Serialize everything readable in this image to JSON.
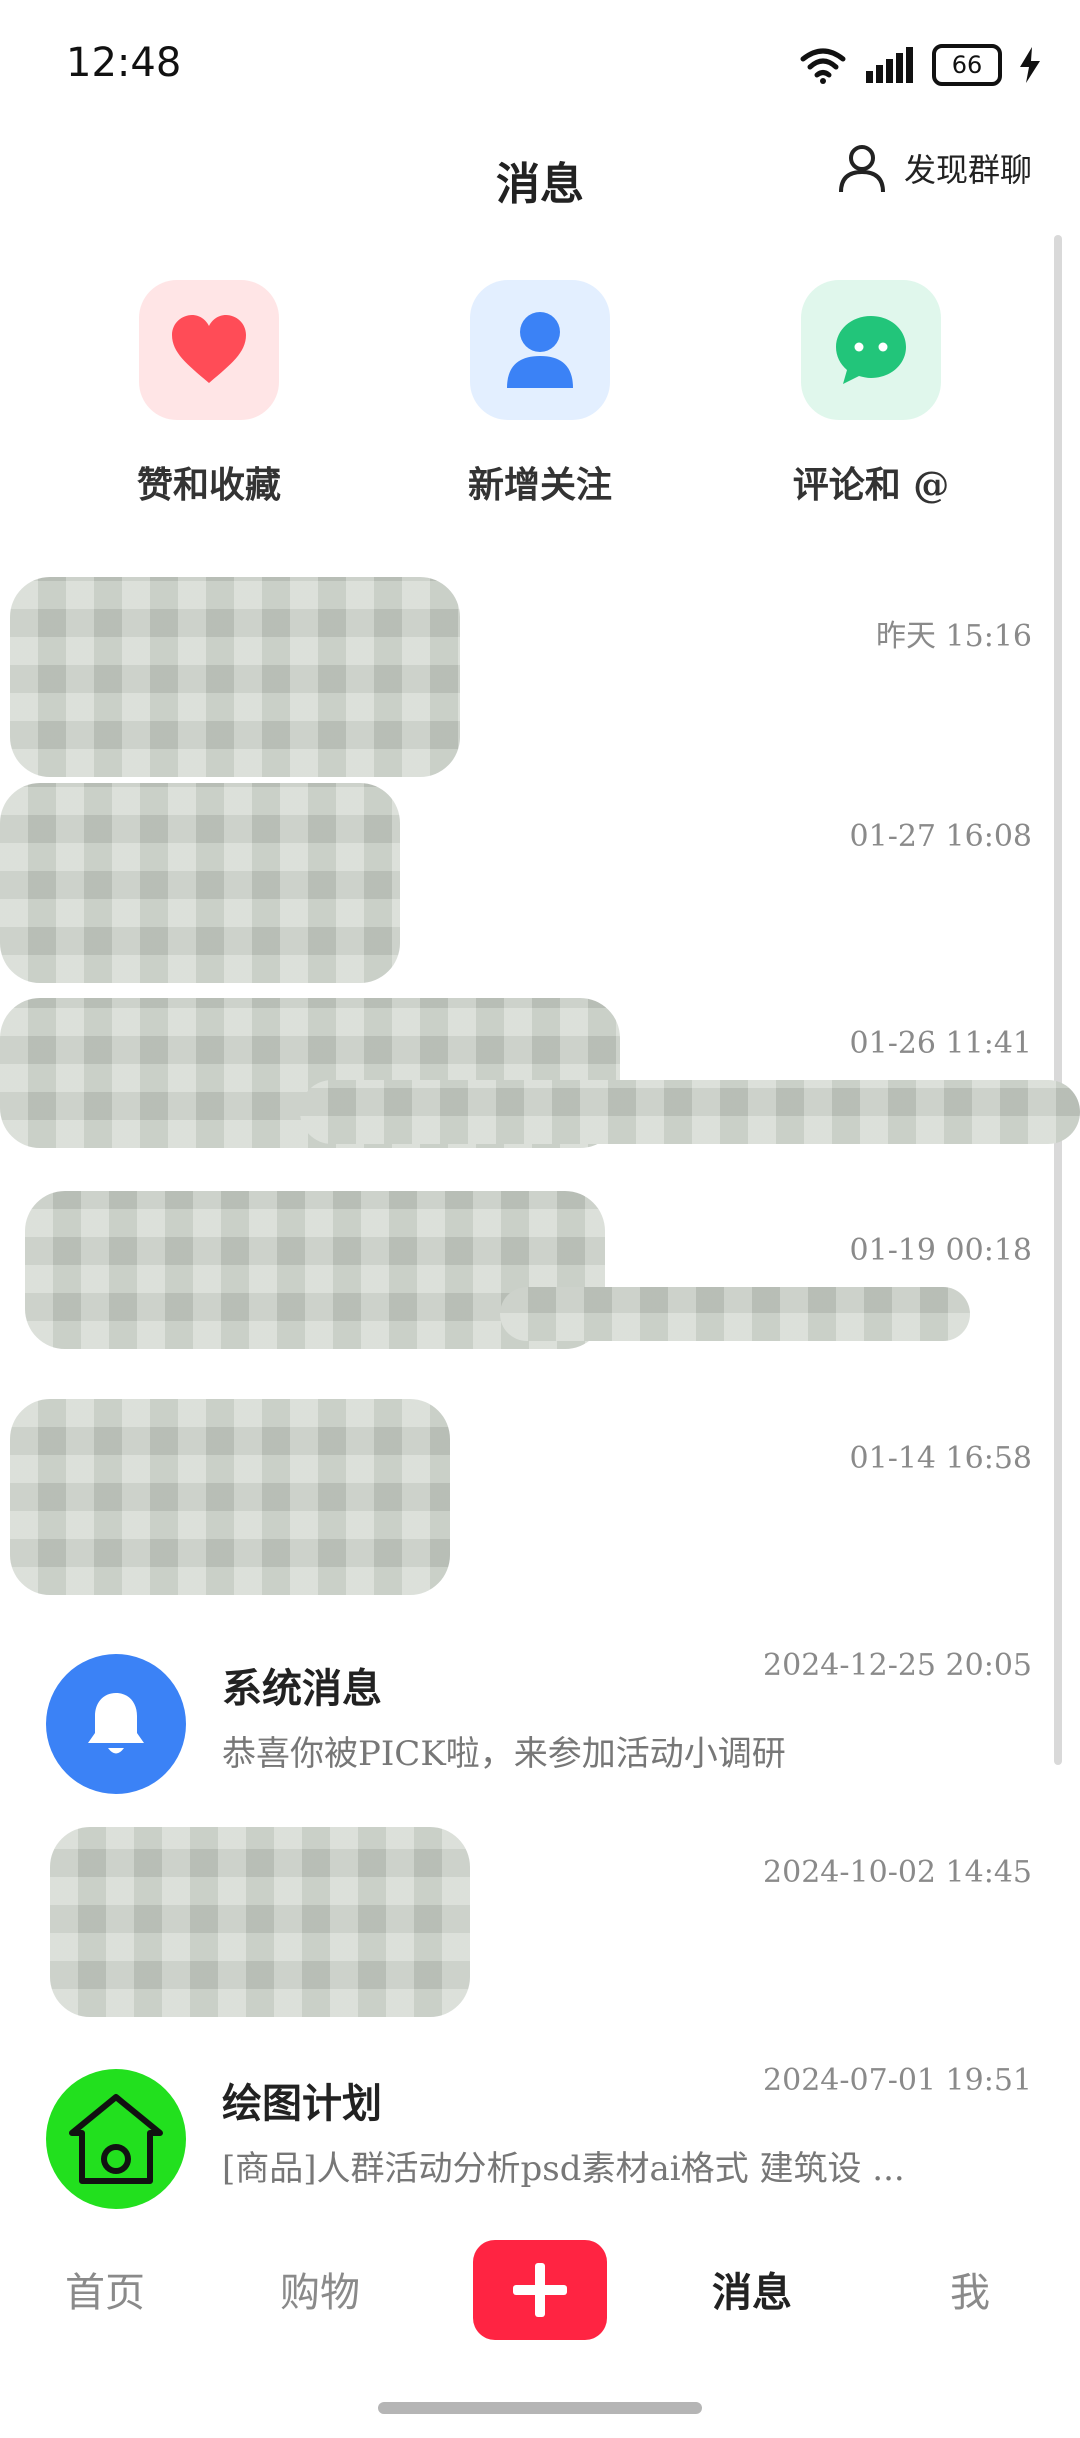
{
  "status_bar": {
    "time": "12:48",
    "battery": "66"
  },
  "header": {
    "title": "消息",
    "discover_label": "发现群聊"
  },
  "quick_actions": [
    {
      "label": "赞和收藏",
      "icon": "heart-icon",
      "bg": "#ffe5e6",
      "color": "#ff4c57"
    },
    {
      "label": "新增关注",
      "icon": "person-icon",
      "bg": "#e3efff",
      "color": "#3b82f6"
    },
    {
      "label": "评论和 @",
      "icon": "chat-bubble-icon",
      "bg": "#e0f7ec",
      "color": "#22c57a"
    }
  ],
  "messages": [
    {
      "time": "昨天 15:16",
      "redacted": true
    },
    {
      "time": "01-27 16:08",
      "redacted": true
    },
    {
      "time": "01-26 11:41",
      "redacted": true
    },
    {
      "time": "01-19 00:18",
      "redacted": true
    },
    {
      "time": "01-14 16:58",
      "redacted": true
    },
    {
      "title": "系统消息",
      "preview": "恭喜你被PICK啦，来参加活动小调研",
      "time": "2024-12-25 20:05",
      "avatar_icon": "bell-icon",
      "avatar_color": "#3b82f6"
    },
    {
      "time": "2024-10-02 14:45",
      "redacted": true
    },
    {
      "title": "绘图计划",
      "preview": "[商品]人群活动分析psd素材ai格式 建筑设 ...",
      "time": "2024-07-01 19:51",
      "avatar_icon": "house-icon",
      "avatar_color": "#22e01e"
    }
  ],
  "tabs": [
    {
      "label": "首页",
      "active": false
    },
    {
      "label": "购物",
      "active": false
    },
    {
      "label": "消息",
      "active": true
    },
    {
      "label": "我",
      "active": false
    }
  ],
  "colors": {
    "accent": "#ff2442"
  }
}
